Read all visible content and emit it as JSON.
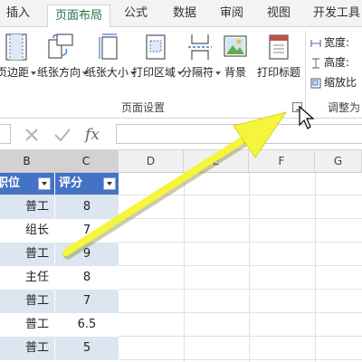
{
  "ribbon_tabs": [
    "插入",
    "页面布局",
    "公式",
    "数据",
    "审阅",
    "视图",
    "开发工具"
  ],
  "active_tab": "页面布局",
  "page_setup": {
    "buttons": [
      "页边距",
      "纸张方向",
      "纸张大小",
      "打印区域",
      "分隔符",
      "背景",
      "打印标题"
    ],
    "group_label": "页面设置"
  },
  "scale_to_fit": {
    "width_label": "宽度:",
    "height_label": "高度:",
    "scale_label": "缩放比",
    "group_label": "调整为"
  },
  "formula_bar": {
    "cancel_icon": "x-icon",
    "enter_icon": "check-icon",
    "function_label": "fx",
    "value": ""
  },
  "columns": [
    "B",
    "C",
    "D",
    "E",
    "F",
    "G"
  ],
  "table": {
    "headers": [
      "职位",
      "评分"
    ],
    "rows": [
      [
        "普工",
        "8"
      ],
      [
        "组长",
        "7"
      ],
      [
        "普工",
        "9"
      ],
      [
        "主任",
        "8"
      ],
      [
        "普工",
        "7"
      ],
      [
        "普工",
        "6.5"
      ],
      [
        "普工",
        "5"
      ]
    ]
  },
  "colors": {
    "accent": "#217346",
    "table_header": "#4472c4",
    "table_band": "#dce6f1",
    "arrow": "#f5f53b"
  }
}
